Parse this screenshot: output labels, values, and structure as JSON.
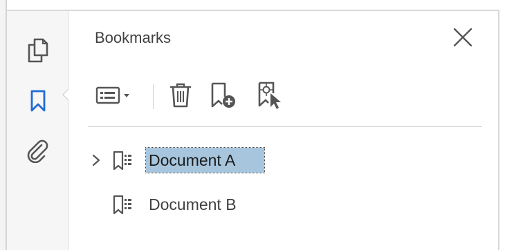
{
  "panel": {
    "title": "Bookmarks"
  },
  "left_rail": {
    "items": [
      {
        "icon": "page-thumbnails-icon"
      },
      {
        "icon": "bookmark-icon",
        "active": true
      },
      {
        "icon": "paperclip-icon"
      }
    ]
  },
  "toolbar": {
    "buttons": [
      {
        "icon": "options-menu-icon"
      },
      {
        "icon": "trash-icon"
      },
      {
        "icon": "new-bookmark-icon"
      },
      {
        "icon": "bookmark-from-selection-icon"
      }
    ]
  },
  "bookmarks": [
    {
      "label": "Document A",
      "expandable": true,
      "selected": true
    },
    {
      "label": "Document B",
      "expandable": false,
      "selected": false
    }
  ],
  "colors": {
    "accent": "#1f6bd6",
    "icon_gray": "#555555",
    "selection": "#a7c6de"
  }
}
